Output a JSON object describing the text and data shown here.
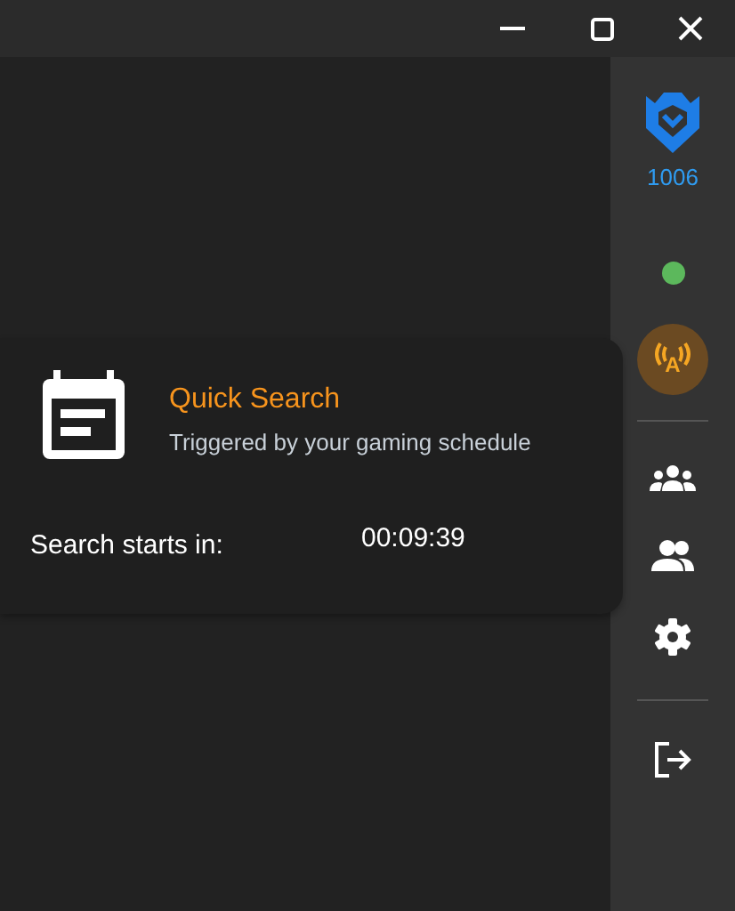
{
  "sidebar": {
    "rank": "1006",
    "status": {
      "color": "#5cb85c"
    },
    "stream_badge": "A"
  },
  "card": {
    "title": "Quick Search",
    "subtitle": "Triggered by your gaming schedule",
    "label": "Search starts in:",
    "countdown": "00:09:39"
  }
}
